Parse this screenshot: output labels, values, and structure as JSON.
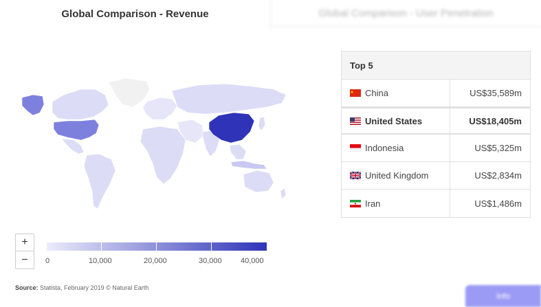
{
  "tabs": [
    {
      "label": "Global Comparison - Revenue",
      "active": true
    },
    {
      "label": "Global Comparison - User Penetration",
      "active": false
    }
  ],
  "colors": {
    "scale_low": "#ececfb",
    "scale_high": "#2f33b8",
    "china": "#2f33b8",
    "united_states": "#7e80de",
    "other_data": "#dcdcf6",
    "no_data": "#f1f1f1"
  },
  "zoom": {
    "in_label": "+",
    "out_label": "−"
  },
  "legend": {
    "ticks": [
      "0",
      "10,000",
      "20,000",
      "30,000",
      "40,000"
    ]
  },
  "source": {
    "label": "Source:",
    "text": "Statista, February 2019 © Natural Earth"
  },
  "top5": {
    "title": "Top 5",
    "rows": [
      {
        "flag": "china-flag-icon",
        "country": "China",
        "value": "US$35,589m",
        "highlight": false
      },
      {
        "flag": "united-states-flag-icon",
        "country": "United States",
        "value": "US$18,405m",
        "highlight": true
      },
      {
        "flag": "indonesia-flag-icon",
        "country": "Indonesia",
        "value": "US$5,325m",
        "highlight": false
      },
      {
        "flag": "united-kingdom-flag-icon",
        "country": "United Kingdom",
        "value": "US$2,834m",
        "highlight": false
      },
      {
        "flag": "iran-flag-icon",
        "country": "Iran",
        "value": "US$1,486m",
        "highlight": false
      }
    ]
  },
  "info_button": {
    "label": "Info"
  }
}
